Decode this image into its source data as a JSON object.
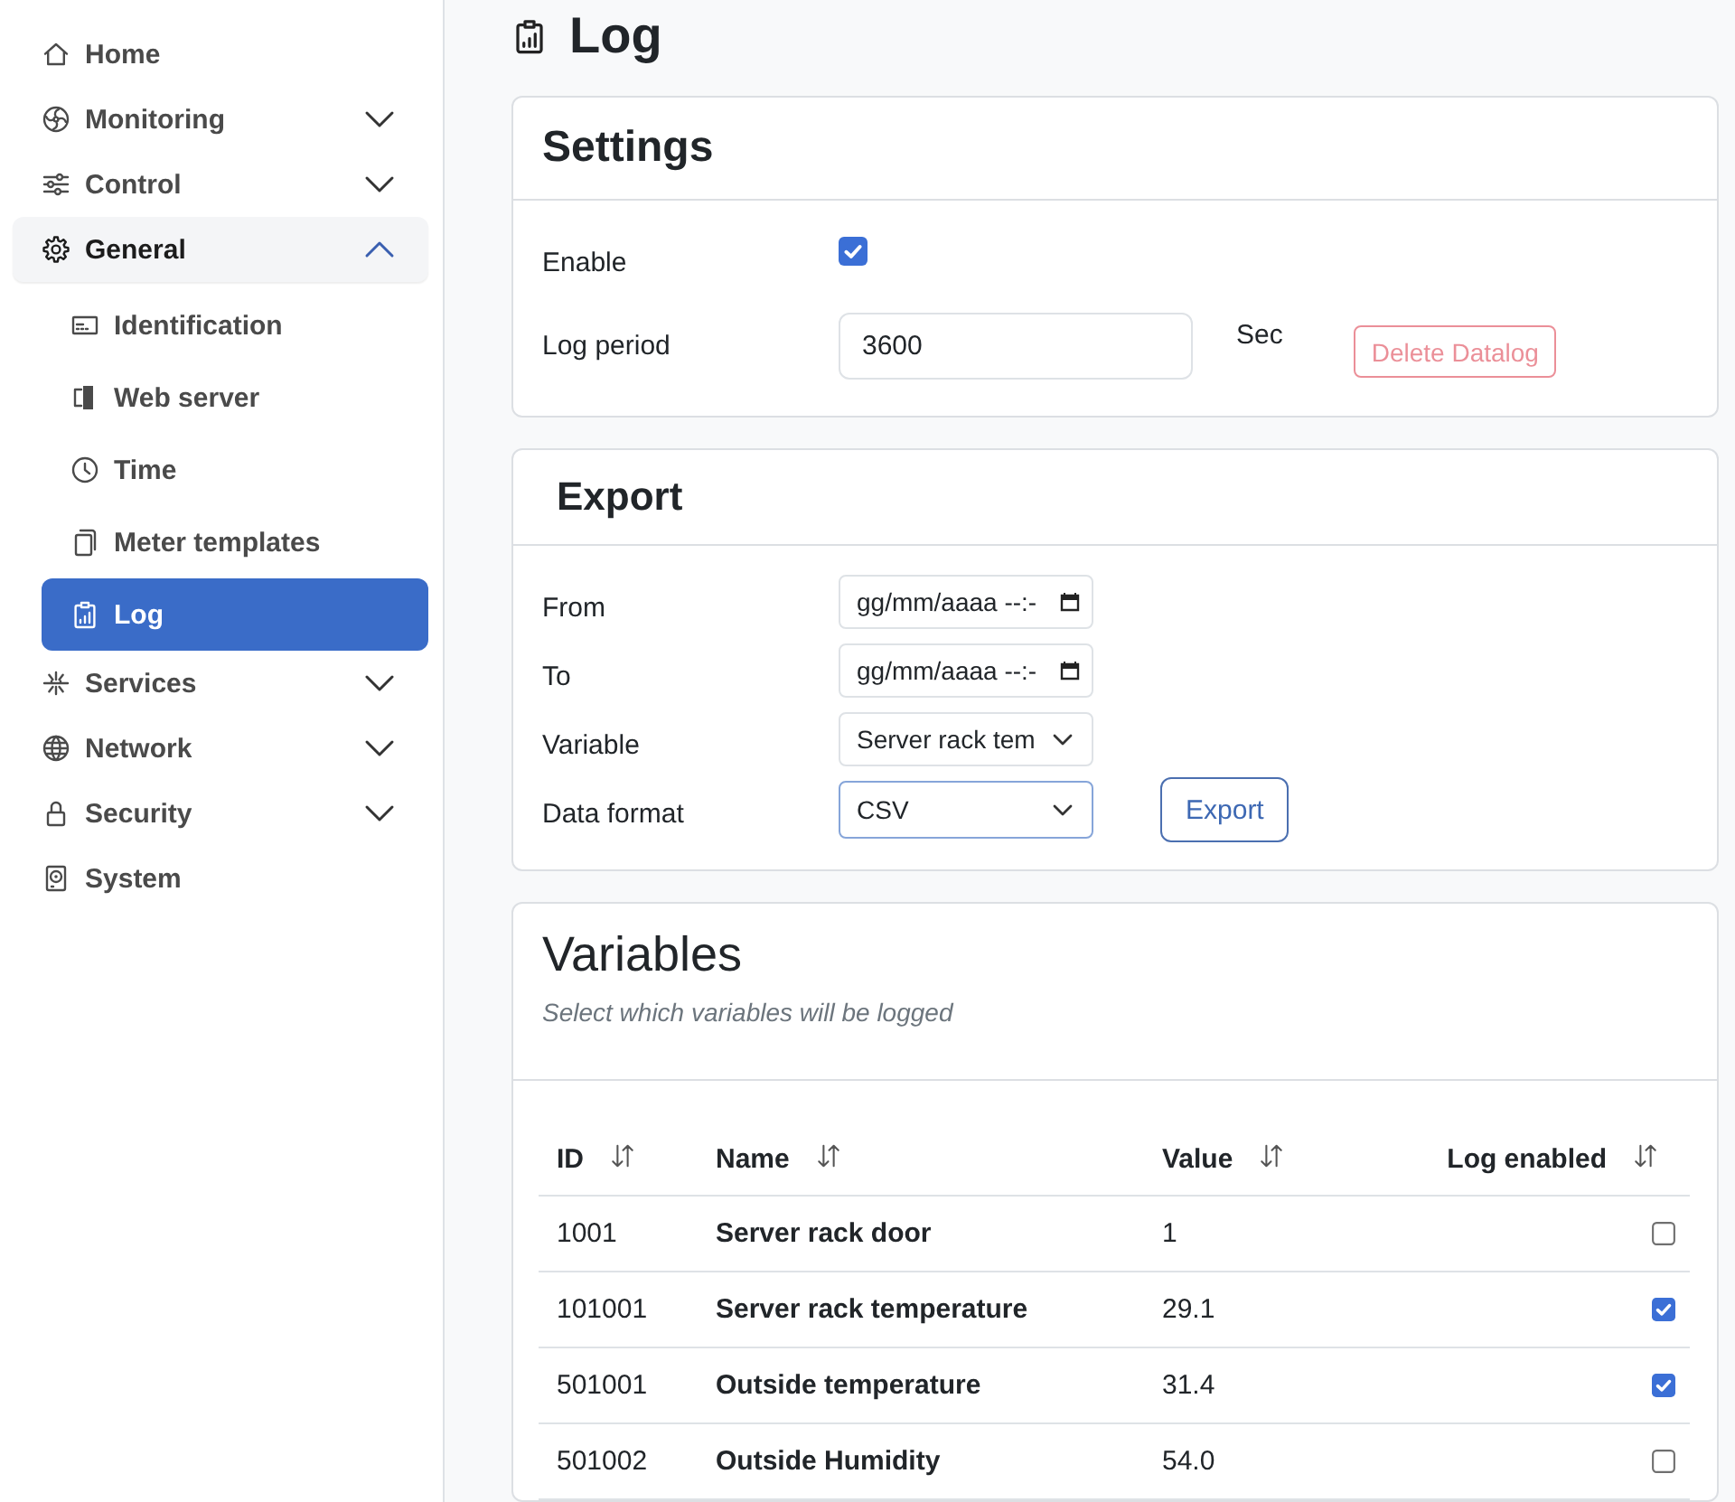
{
  "sidebar": {
    "items": [
      {
        "label": "Home",
        "kind": "link",
        "selected": false
      },
      {
        "label": "Monitoring",
        "kind": "group",
        "expanded": false,
        "selected": false
      },
      {
        "label": "Control",
        "kind": "group",
        "expanded": false,
        "selected": false
      },
      {
        "label": "General",
        "kind": "group",
        "expanded": true,
        "selected": false,
        "children": [
          {
            "label": "Identification",
            "selected": false
          },
          {
            "label": "Web server",
            "selected": false
          },
          {
            "label": "Time",
            "selected": false
          },
          {
            "label": "Meter templates",
            "selected": false
          },
          {
            "label": "Log",
            "selected": true
          }
        ]
      },
      {
        "label": "Services",
        "kind": "group",
        "expanded": false,
        "selected": false
      },
      {
        "label": "Network",
        "kind": "group",
        "expanded": false,
        "selected": false
      },
      {
        "label": "Security",
        "kind": "group",
        "expanded": false,
        "selected": false
      },
      {
        "label": "System",
        "kind": "link",
        "selected": false
      }
    ]
  },
  "page": {
    "title": "Log"
  },
  "settings": {
    "title": "Settings",
    "enable": {
      "label": "Enable",
      "checked": true
    },
    "log_period": {
      "label": "Log period",
      "value": "3600",
      "unit": "Sec"
    },
    "delete_button": {
      "label": "Delete Datalog",
      "disabled": true
    }
  },
  "export": {
    "title": "Export",
    "fields": [
      {
        "label": "From",
        "kind": "datetime",
        "placeholder": "gg/mm/aaaa --:-",
        "focused": false
      },
      {
        "label": "To",
        "kind": "datetime",
        "placeholder": "gg/mm/aaaa --:-",
        "focused": false
      },
      {
        "label": "Variable",
        "kind": "select",
        "value": "Server rack tem",
        "focused": false
      },
      {
        "label": "Data format",
        "kind": "select",
        "value": "CSV",
        "focused": true
      }
    ],
    "button": "Export"
  },
  "variables": {
    "title": "Variables",
    "subtitle": "Select which variables will be logged",
    "table": {
      "columns": [
        "ID",
        "Name",
        "Value",
        "Log enabled"
      ],
      "rows": [
        {
          "id": "1001",
          "name": "Server rack door",
          "value": "1",
          "log_enabled": false
        },
        {
          "id": "101001",
          "name": "Server rack temperature",
          "value": "29.1",
          "log_enabled": true
        },
        {
          "id": "501001",
          "name": "Outside temperature",
          "value": "31.4",
          "log_enabled": true
        },
        {
          "id": "501002",
          "name": "Outside Humidity",
          "value": "54.0",
          "log_enabled": false
        }
      ]
    }
  }
}
